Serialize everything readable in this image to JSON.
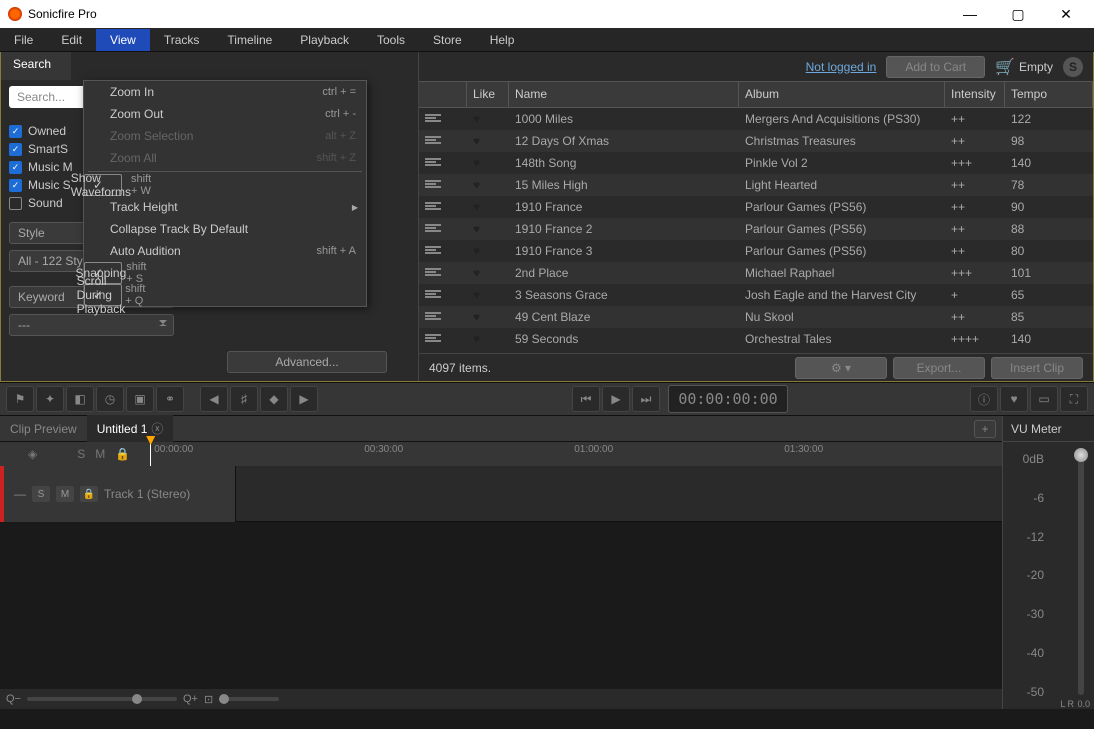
{
  "app": {
    "title": "Sonicfire Pro"
  },
  "menubar": [
    "File",
    "Edit",
    "View",
    "Tracks",
    "Timeline",
    "Playback",
    "Tools",
    "Store",
    "Help"
  ],
  "view_menu": [
    {
      "label": "Zoom In",
      "sc": "ctrl + =",
      "type": "item"
    },
    {
      "label": "Zoom Out",
      "sc": "ctrl + -",
      "type": "item"
    },
    {
      "label": "Zoom Selection",
      "sc": "alt + Z",
      "type": "disabled"
    },
    {
      "label": "Zoom All",
      "sc": "shift + Z",
      "type": "disabled"
    },
    {
      "type": "sep"
    },
    {
      "label": "Show Waveforms",
      "sc": "shift + W",
      "type": "checked"
    },
    {
      "label": "Track Height",
      "sc": "",
      "type": "arrow"
    },
    {
      "label": "Collapse Track By Default",
      "sc": "",
      "type": "item"
    },
    {
      "label": "Auto Audition",
      "sc": "shift + A",
      "type": "item"
    },
    {
      "label": "Snapping",
      "sc": "shift + S",
      "type": "checked"
    },
    {
      "label": "Scroll During Playback",
      "sc": "shift + Q",
      "type": "checked"
    }
  ],
  "search": {
    "tab": "Search",
    "placeholder": "Search...",
    "checks": [
      {
        "label": "Owned",
        "on": true
      },
      {
        "label": "SmartS",
        "on": true
      },
      {
        "label": "Music M",
        "on": true
      },
      {
        "label": "Music S",
        "on": true
      },
      {
        "label": "Sound",
        "on": false
      }
    ],
    "style_label": "Style",
    "style_value": "All - 122 Style(s)",
    "keyword_label": "Keyword",
    "keyword_value": "---",
    "advanced": "Advanced..."
  },
  "topright": {
    "login": "Not logged in",
    "add_cart": "Add to Cart",
    "empty": "Empty"
  },
  "columns": {
    "like": "Like",
    "name": "Name",
    "album": "Album",
    "intensity": "Intensity",
    "tempo": "Tempo"
  },
  "rows": [
    {
      "name": "1000 Miles",
      "album": "Mergers And Acquisitions (PS30)",
      "intensity": "++",
      "tempo": "122"
    },
    {
      "name": "12 Days Of Xmas",
      "album": "Christmas Treasures",
      "intensity": "++",
      "tempo": "98"
    },
    {
      "name": "148th Song",
      "album": "Pinkle Vol 2",
      "intensity": "+++",
      "tempo": "140"
    },
    {
      "name": "15 Miles High",
      "album": "Light Hearted",
      "intensity": "++",
      "tempo": "78"
    },
    {
      "name": "1910 France",
      "album": "Parlour Games (PS56)",
      "intensity": "++",
      "tempo": "90"
    },
    {
      "name": "1910 France 2",
      "album": "Parlour Games (PS56)",
      "intensity": "++",
      "tempo": "88"
    },
    {
      "name": "1910 France 3",
      "album": "Parlour Games (PS56)",
      "intensity": "++",
      "tempo": "80"
    },
    {
      "name": "2nd Place",
      "album": "Michael Raphael",
      "intensity": "+++",
      "tempo": "101"
    },
    {
      "name": "3 Seasons Grace",
      "album": "Josh Eagle and the Harvest City",
      "intensity": "+",
      "tempo": "65"
    },
    {
      "name": "49 Cent Blaze",
      "album": "Nu Skool",
      "intensity": "++",
      "tempo": "85"
    },
    {
      "name": "59 Seconds",
      "album": "Orchestral Tales",
      "intensity": "++++",
      "tempo": "140"
    }
  ],
  "items_count": "4097 items.",
  "export_btn": "Export...",
  "insert_btn": "Insert Clip",
  "timecode": "00:00:00:00",
  "tabs": {
    "preview": "Clip Preview",
    "untitled": "Untitled 1"
  },
  "ruler": [
    "00:00:00",
    "00:30:00",
    "01:00:00",
    "01:30:00"
  ],
  "track": {
    "name": "Track 1 (Stereo)"
  },
  "vu": {
    "title": "VU Meter",
    "scale": [
      "0dB",
      "-6",
      "-12",
      "-20",
      "-30",
      "-40",
      "-50"
    ],
    "lr": "L   R",
    "val": "0.0"
  }
}
